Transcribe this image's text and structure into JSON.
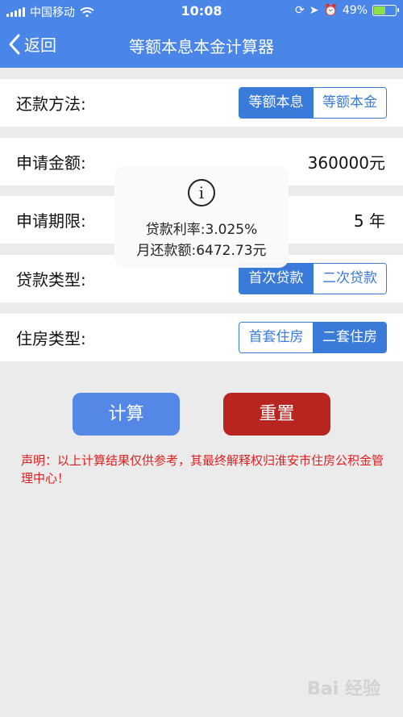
{
  "status_bar": {
    "carrier": "中国移动",
    "time": "10:08",
    "battery_percent": "49%",
    "battery_level": 0.49
  },
  "nav": {
    "back_label": "返回",
    "title": "等额本息本金计算器"
  },
  "form": {
    "repayment_method": {
      "label": "还款方法:",
      "options": [
        "等额本息",
        "等额本金"
      ],
      "selected": "等额本息"
    },
    "amount": {
      "label": "申请金额:",
      "value": "360000元"
    },
    "term": {
      "label": "申请期限:",
      "value": "5 年"
    },
    "loan_type": {
      "label": "贷款类型:",
      "options": [
        "首次贷款",
        "二次贷款"
      ],
      "selected": "首次贷款"
    },
    "house_type": {
      "label": "住房类型:",
      "options": [
        "首套住房",
        "二套住房"
      ],
      "selected": "二套住房"
    }
  },
  "popup": {
    "icon": "info-icon",
    "line1": "贷款利率:3.025%",
    "line2": "月还款额:6472.73元"
  },
  "buttons": {
    "calculate": "计算",
    "reset": "重置"
  },
  "notice": "声明：以上计算结果仅供参考，其最终解释权归淮安市住房公积金管理中心！",
  "watermark": "Bai 经验",
  "colors": {
    "accent": "#4a86e8",
    "segment": "#3a7ad9",
    "reset_button": "#b8241f",
    "notice_text": "#e02020"
  }
}
